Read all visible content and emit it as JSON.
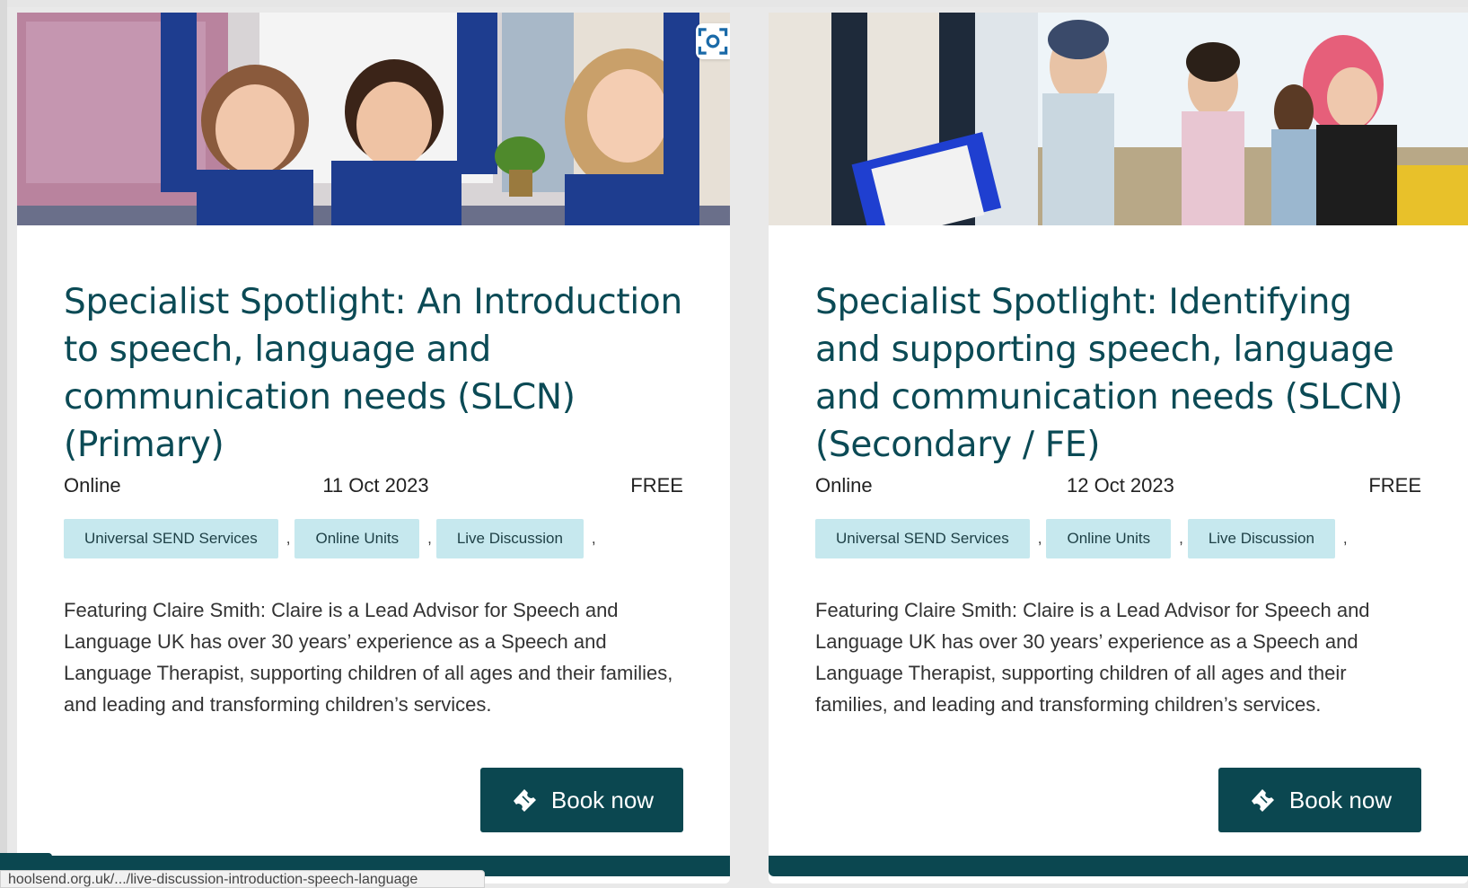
{
  "cards": [
    {
      "title": "Specialist Spotlight: An Introduction to speech, language and communication needs (SLCN) (Primary)",
      "location": "Online",
      "date": "11 Oct 2023",
      "price": "FREE",
      "tags": [
        "Universal SEND Services",
        "Online Units",
        "Live Discussion"
      ],
      "tag_separator": ",",
      "description": "Featuring Claire Smith: Claire is a Lead Advisor for Speech and Language UK has over 30 years’ experience as a Speech and Language Therapist, supporting children of all ages and their families, and leading and transforming children’s services.",
      "book_label": "Book now",
      "image_icon": "visual-search-icon"
    },
    {
      "title": "Specialist Spotlight: Identifying and supporting speech, language and communication needs (SLCN) (Secondary / FE)",
      "location": "Online",
      "date": "12 Oct 2023",
      "price": "FREE",
      "tags": [
        "Universal SEND Services",
        "Online Units",
        "Live Discussion"
      ],
      "tag_separator": ",",
      "description": "Featuring Claire Smith: Claire is a Lead Advisor for Speech and Language UK has over 30 years’ experience as a Speech and Language Therapist, supporting children of all ages and their families, and leading and transforming children’s services.",
      "book_label": "Book now"
    }
  ],
  "status_bar": {
    "url": "hoolsend.org.uk/.../live-discussion-introduction-speech-language"
  },
  "colors": {
    "brand_dark": "#0b4750",
    "title": "#0b4a55",
    "tag_bg": "#c6e8ee"
  }
}
